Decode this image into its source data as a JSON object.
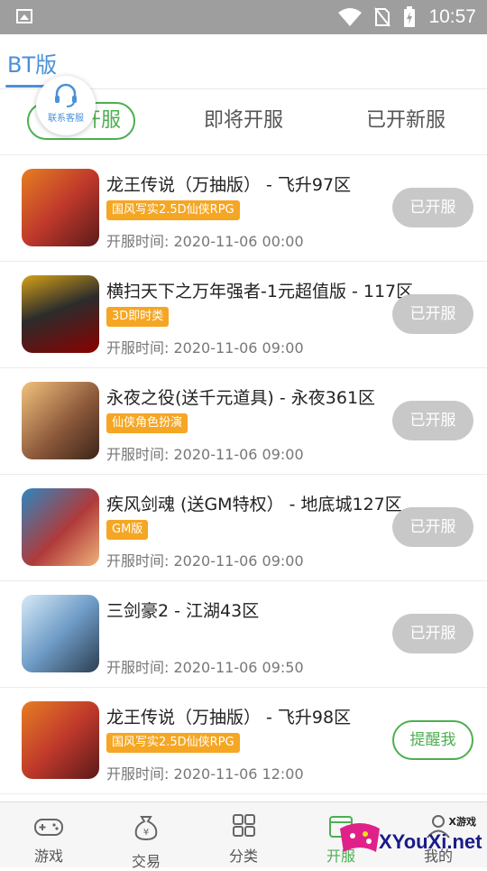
{
  "status_bar": {
    "time": "10:57",
    "icons": [
      "image-icon",
      "wifi-icon",
      "no-sim-icon",
      "battery-charging-icon"
    ]
  },
  "header": {
    "title": "BT版"
  },
  "customer_service": {
    "label": "联系客服"
  },
  "tabs": [
    {
      "label": "开服",
      "active": true
    },
    {
      "label": "即将开服",
      "active": false
    },
    {
      "label": "已开新服",
      "active": false
    }
  ],
  "games": [
    {
      "name": "龙王传说（万抽版） - 飞升97区",
      "tag": "国风写实2.5D仙侠RPG",
      "time": "开服时间: 2020-11-06 00:00",
      "button": "已开服",
      "state": "done",
      "thumb_color": "#c0392b"
    },
    {
      "name": "横扫天下之万年强者-1元超值版 - 117区",
      "tag": "3D即时类",
      "time": "开服时间: 2020-11-06 09:00",
      "button": "已开服",
      "state": "done",
      "thumb_color": "#2c2c2c"
    },
    {
      "name": "永夜之役(送千元道具) - 永夜361区",
      "tag": "仙侠角色扮演",
      "time": "开服时间: 2020-11-06 09:00",
      "button": "已开服",
      "state": "done",
      "thumb_color": "#8e5a3c"
    },
    {
      "name": "疾风剑魂 (送GM特权） - 地底城127区",
      "tag": "GM版",
      "time": "开服时间: 2020-11-06 09:00",
      "button": "已开服",
      "state": "done",
      "thumb_color": "#b03a3a"
    },
    {
      "name": "三剑豪2 - 江湖43区",
      "tag": "",
      "time": "开服时间: 2020-11-06 09:50",
      "button": "已开服",
      "state": "done",
      "thumb_color": "#6f9cc7"
    },
    {
      "name": "龙王传说（万抽版） - 飞升98区",
      "tag": "国风写实2.5D仙侠RPG",
      "time": "开服时间: 2020-11-06 12:00",
      "button": "提醒我",
      "state": "remind",
      "thumb_color": "#c0392b"
    }
  ],
  "nav": [
    {
      "label": "游戏",
      "icon": "gamepad-icon",
      "active": false
    },
    {
      "label": "交易",
      "icon": "money-bag-icon",
      "active": false
    },
    {
      "label": "分类",
      "icon": "grid-icon",
      "active": false
    },
    {
      "label": "开服",
      "icon": "calendar-icon",
      "active": true
    },
    {
      "label": "我的",
      "icon": "user-icon",
      "active": false
    }
  ],
  "watermark": {
    "small": "X游戏",
    "big": "XYouXi.net"
  },
  "colors": {
    "accent_green": "#4caf50",
    "accent_blue": "#4a90d9",
    "tag_orange": "#f5a623",
    "done_gray": "#c8c8c8"
  }
}
